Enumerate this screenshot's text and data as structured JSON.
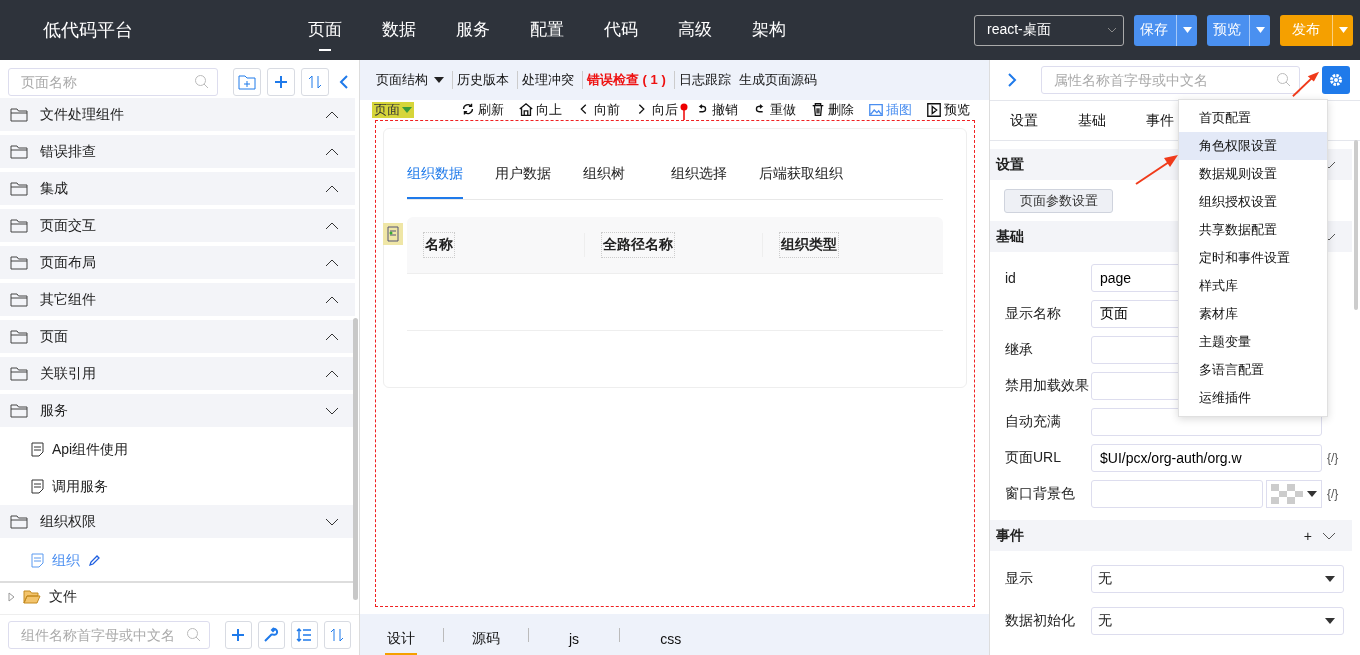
{
  "header": {
    "logo": "低代码平台",
    "nav": [
      {
        "label": "页面",
        "selected": true
      },
      {
        "label": "数据",
        "selected": false
      },
      {
        "label": "服务",
        "selected": false
      },
      {
        "label": "配置",
        "selected": false
      },
      {
        "label": "代码",
        "selected": false
      },
      {
        "label": "高级",
        "selected": false
      },
      {
        "label": "架构",
        "selected": false
      }
    ],
    "device_select": "react-桌面",
    "actions": [
      {
        "label": "保存",
        "kind": "primary"
      },
      {
        "label": "预览",
        "kind": "primary"
      },
      {
        "label": "发布",
        "kind": "warning"
      }
    ]
  },
  "left_panel": {
    "search": {
      "placeholder": "页面名称"
    },
    "tree": [
      {
        "label": "文件处理组件",
        "expanded": false
      },
      {
        "label": "错误排查",
        "expanded": false
      },
      {
        "label": "集成",
        "expanded": false
      },
      {
        "label": "页面交互",
        "expanded": false
      },
      {
        "label": "页面布局",
        "expanded": false
      },
      {
        "label": "其它组件",
        "expanded": false
      },
      {
        "label": "页面",
        "expanded": false
      },
      {
        "label": "关联引用",
        "expanded": false
      },
      {
        "label": "服务",
        "expanded": true,
        "children": [
          {
            "label": "Api组件使用",
            "selected": false
          },
          {
            "label": "调用服务",
            "selected": false
          }
        ]
      },
      {
        "label": "组织权限",
        "expanded": true,
        "children": [
          {
            "label": "组织",
            "selected": true
          }
        ]
      }
    ],
    "files": {
      "label": "文件",
      "expanded": false
    },
    "component_search": {
      "placeholder": "组件名称首字母或中文名"
    }
  },
  "editor": {
    "toolbar": [
      {
        "label": "页面结构",
        "kind": "dropdown",
        "separated": false
      },
      {
        "label": "历史版本",
        "kind": "link",
        "separated": true
      },
      {
        "label": "处理冲突",
        "kind": "link",
        "separated": true
      },
      {
        "label": "错误检查 ( 1 )",
        "kind": "error",
        "separated": true
      },
      {
        "label": "日志跟踪",
        "kind": "link",
        "separated": true
      },
      {
        "label": "生成页面源码",
        "kind": "link",
        "separated": false
      }
    ],
    "page_tag": "页面",
    "tools": [
      {
        "label": "刷新",
        "kind": "refresh",
        "active": false
      },
      {
        "label": "向上",
        "kind": "home",
        "active": false
      },
      {
        "label": "向前",
        "kind": "back",
        "active": false
      },
      {
        "label": "向后",
        "kind": "forward",
        "active": false
      },
      {
        "label": "撤销",
        "kind": "undo",
        "active": false
      },
      {
        "label": "重做",
        "kind": "redo",
        "active": false
      },
      {
        "label": "删除",
        "kind": "delete",
        "active": false
      },
      {
        "label": "插图",
        "kind": "image",
        "active": true
      },
      {
        "label": "预览",
        "kind": "play",
        "active": false
      }
    ],
    "tabs": [
      {
        "label": "组织数据",
        "selected": true
      },
      {
        "label": "用户数据",
        "selected": false
      },
      {
        "label": "组织树",
        "selected": false
      },
      {
        "label": "组织选择",
        "selected": false
      },
      {
        "label": "后端获取组织",
        "selected": false
      }
    ],
    "table": {
      "columns": [
        "名称",
        "全路径名称",
        "组织类型"
      ]
    },
    "bottom_tabs": [
      {
        "label": "设计",
        "selected": true
      },
      {
        "label": "源码",
        "selected": false
      },
      {
        "label": "js",
        "selected": false
      },
      {
        "label": "css",
        "selected": false
      }
    ]
  },
  "properties": {
    "search": {
      "placeholder": "属性名称首字母或中文名"
    },
    "tabs": [
      "设置",
      "基础",
      "事件"
    ],
    "sections": [
      {
        "title": "设置",
        "kind": "buttons",
        "buttons": [
          "页面参数设置"
        ]
      },
      {
        "title": "基础",
        "kind": "fields",
        "fields": [
          {
            "label": "id",
            "kind": "input",
            "value": "page"
          },
          {
            "label": "显示名称",
            "kind": "input",
            "value": "页面"
          },
          {
            "label": "继承",
            "kind": "input"
          },
          {
            "label": "禁用加载效果",
            "kind": "input"
          },
          {
            "label": "自动充满",
            "kind": "input"
          },
          {
            "label": "页面URL",
            "kind": "input",
            "value": "$UI/pcx/org-auth/org.w",
            "expr": "{/}"
          },
          {
            "label": "窗口背景色",
            "kind": "color",
            "expr": "{/}"
          }
        ]
      },
      {
        "title": "事件",
        "kind": "fields",
        "add": "+",
        "fields": [
          {
            "label": "显示",
            "kind": "select",
            "value": "无"
          },
          {
            "label": "数据初始化",
            "kind": "select",
            "value": "无"
          }
        ]
      }
    ],
    "settings_menu": [
      {
        "label": "首页配置",
        "selected": false
      },
      {
        "label": "角色权限设置",
        "selected": true
      },
      {
        "label": "数据规则设置",
        "selected": false
      },
      {
        "label": "组织授权设置",
        "selected": false
      },
      {
        "label": "共享数据配置",
        "selected": false
      },
      {
        "label": "定时和事件设置",
        "selected": false
      },
      {
        "label": "样式库",
        "selected": false
      },
      {
        "label": "素材库",
        "selected": false
      },
      {
        "label": "主题变量",
        "selected": false
      },
      {
        "label": "多语言配置",
        "selected": false
      },
      {
        "label": "运维插件",
        "selected": false
      }
    ]
  }
}
